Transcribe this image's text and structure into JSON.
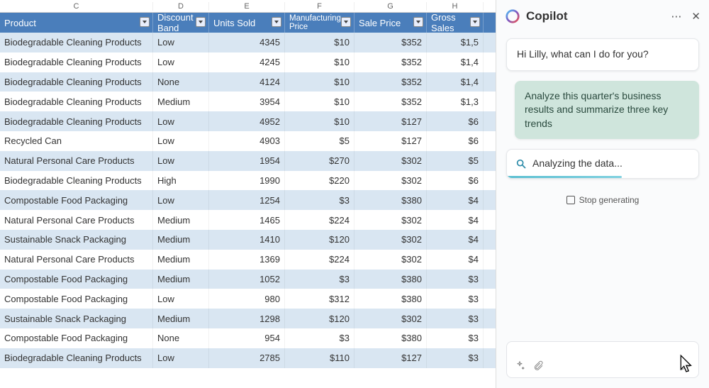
{
  "columns": {
    "letters": [
      "C",
      "D",
      "E",
      "F",
      "G",
      "H"
    ],
    "headers": [
      "Product",
      "Discount Band",
      "Units Sold",
      "Manufacturing Price",
      "Sale Price",
      "Gross Sales"
    ]
  },
  "rows": [
    {
      "product": "Biodegradable Cleaning Products",
      "band": "Low",
      "units": "4345",
      "mfg": "",
      "sale": "$10",
      "gross": "$352",
      "gs": "$1,5"
    },
    {
      "product": "Biodegradable Cleaning Products",
      "band": "Low",
      "units": "4245",
      "mfg": "",
      "sale": "$10",
      "gross": "$352",
      "gs": "$1,4"
    },
    {
      "product": "Biodegradable Cleaning Products",
      "band": "None",
      "units": "4124",
      "mfg": "",
      "sale": "$10",
      "gross": "$352",
      "gs": "$1,4"
    },
    {
      "product": "Biodegradable Cleaning Products",
      "band": "Medium",
      "units": "3954",
      "mfg": "",
      "sale": "$10",
      "gross": "$352",
      "gs": "$1,3"
    },
    {
      "product": "Biodegradable Cleaning Products",
      "band": "Low",
      "units": "4952",
      "mfg": "",
      "sale": "$10",
      "gross": "$127",
      "gs": "$6"
    },
    {
      "product": "Recycled Can",
      "band": "Low",
      "units": "4903",
      "mfg": "",
      "sale": "$5",
      "gross": "$127",
      "gs": "$6"
    },
    {
      "product": "Natural Personal Care Products",
      "band": "Low",
      "units": "1954",
      "mfg": "",
      "sale": "$270",
      "gross": "$302",
      "gs": "$5"
    },
    {
      "product": "Biodegradable Cleaning Products",
      "band": "High",
      "units": "1990",
      "mfg": "",
      "sale": "$220",
      "gross": "$302",
      "gs": "$6"
    },
    {
      "product": "Compostable Food Packaging",
      "band": "Low",
      "units": "1254",
      "mfg": "",
      "sale": "$3",
      "gross": "$380",
      "gs": "$4"
    },
    {
      "product": "Natural Personal Care Products",
      "band": "Medium",
      "units": "1465",
      "mfg": "",
      "sale": "$224",
      "gross": "$302",
      "gs": "$4"
    },
    {
      "product": "Sustainable Snack Packaging",
      "band": "Medium",
      "units": "1410",
      "mfg": "",
      "sale": "$120",
      "gross": "$302",
      "gs": "$4"
    },
    {
      "product": "Natural Personal Care Products",
      "band": "Medium",
      "units": "1369",
      "mfg": "",
      "sale": "$224",
      "gross": "$302",
      "gs": "$4"
    },
    {
      "product": "Compostable Food Packaging",
      "band": "Medium",
      "units": "1052",
      "mfg": "",
      "sale": "$3",
      "gross": "$380",
      "gs": "$3"
    },
    {
      "product": "Compostable Food Packaging",
      "band": "Low",
      "units": "980",
      "mfg": "",
      "sale": "$312",
      "gross": "$380",
      "gs": "$3"
    },
    {
      "product": "Sustainable Snack Packaging",
      "band": "Medium",
      "units": "1298",
      "mfg": "",
      "sale": "$120",
      "gross": "$302",
      "gs": "$3"
    },
    {
      "product": "Compostable Food Packaging",
      "band": "None",
      "units": "954",
      "mfg": "",
      "sale": "$3",
      "gross": "$380",
      "gs": "$3"
    },
    {
      "product": "Biodegradable Cleaning Products",
      "band": "Low",
      "units": "2785",
      "mfg": "",
      "sale": "$110",
      "gross": "$127",
      "gs": "$3"
    }
  ],
  "copilot": {
    "title": "Copilot",
    "greeting": "Hi Lilly, what can I do for you?",
    "user_prompt": "Analyze this quarter's business results and summarize three key trends",
    "status": "Analyzing the data...",
    "stop_label": "Stop generating"
  }
}
